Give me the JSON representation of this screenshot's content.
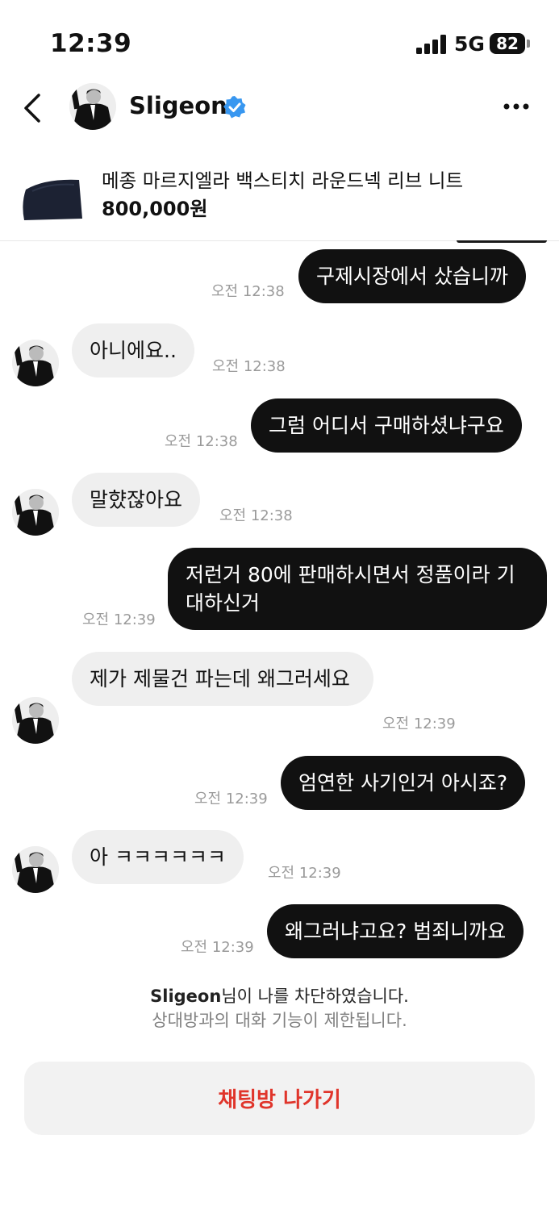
{
  "status": {
    "time": "12:39",
    "network": "5G",
    "battery": "82"
  },
  "header": {
    "name": "Sligeon"
  },
  "product": {
    "title": "메종 마르지엘라 백스티치 라운드넥 리브 니트",
    "price": "800,000원"
  },
  "messages": [
    {
      "side": "out",
      "text": "구제시장에서 샀습니까",
      "time": "오전 12:38"
    },
    {
      "side": "in",
      "text": "아니에요..",
      "time": "오전 12:38"
    },
    {
      "side": "out",
      "text": "그럼 어디서 구매하셨냐구요",
      "time": "오전 12:38"
    },
    {
      "side": "in",
      "text": "말햤잖아요",
      "time": "오전 12:38"
    },
    {
      "side": "out",
      "text": "저런거 80에 판매하시면서 정품이라 기대하신거",
      "time": "오전 12:39"
    },
    {
      "side": "in",
      "text": "제가 제물건 파는데 왜그러세요",
      "time": "오전 12:39"
    },
    {
      "side": "out",
      "text": "엄연한 사기인거 아시죠?",
      "time": "오전 12:39"
    },
    {
      "side": "in",
      "text": "아 ㅋㅋㅋㅋㅋㅋ",
      "time": "오전 12:39"
    },
    {
      "side": "out",
      "text": "왜그러냐고요? 범죄니까요",
      "time": "오전 12:39"
    }
  ],
  "notice": {
    "name": "Sligeon",
    "line1_suffix": "님이 나를 차단하였습니다.",
    "line2": "상대방과의 대화 기능이 제한됩니다."
  },
  "actions": {
    "leave_label": "채팅방 나가기"
  },
  "colors": {
    "accent_red": "#e0352b",
    "verified_blue": "#3897f0",
    "out_bubble": "#111111",
    "in_bubble": "#efefef"
  }
}
